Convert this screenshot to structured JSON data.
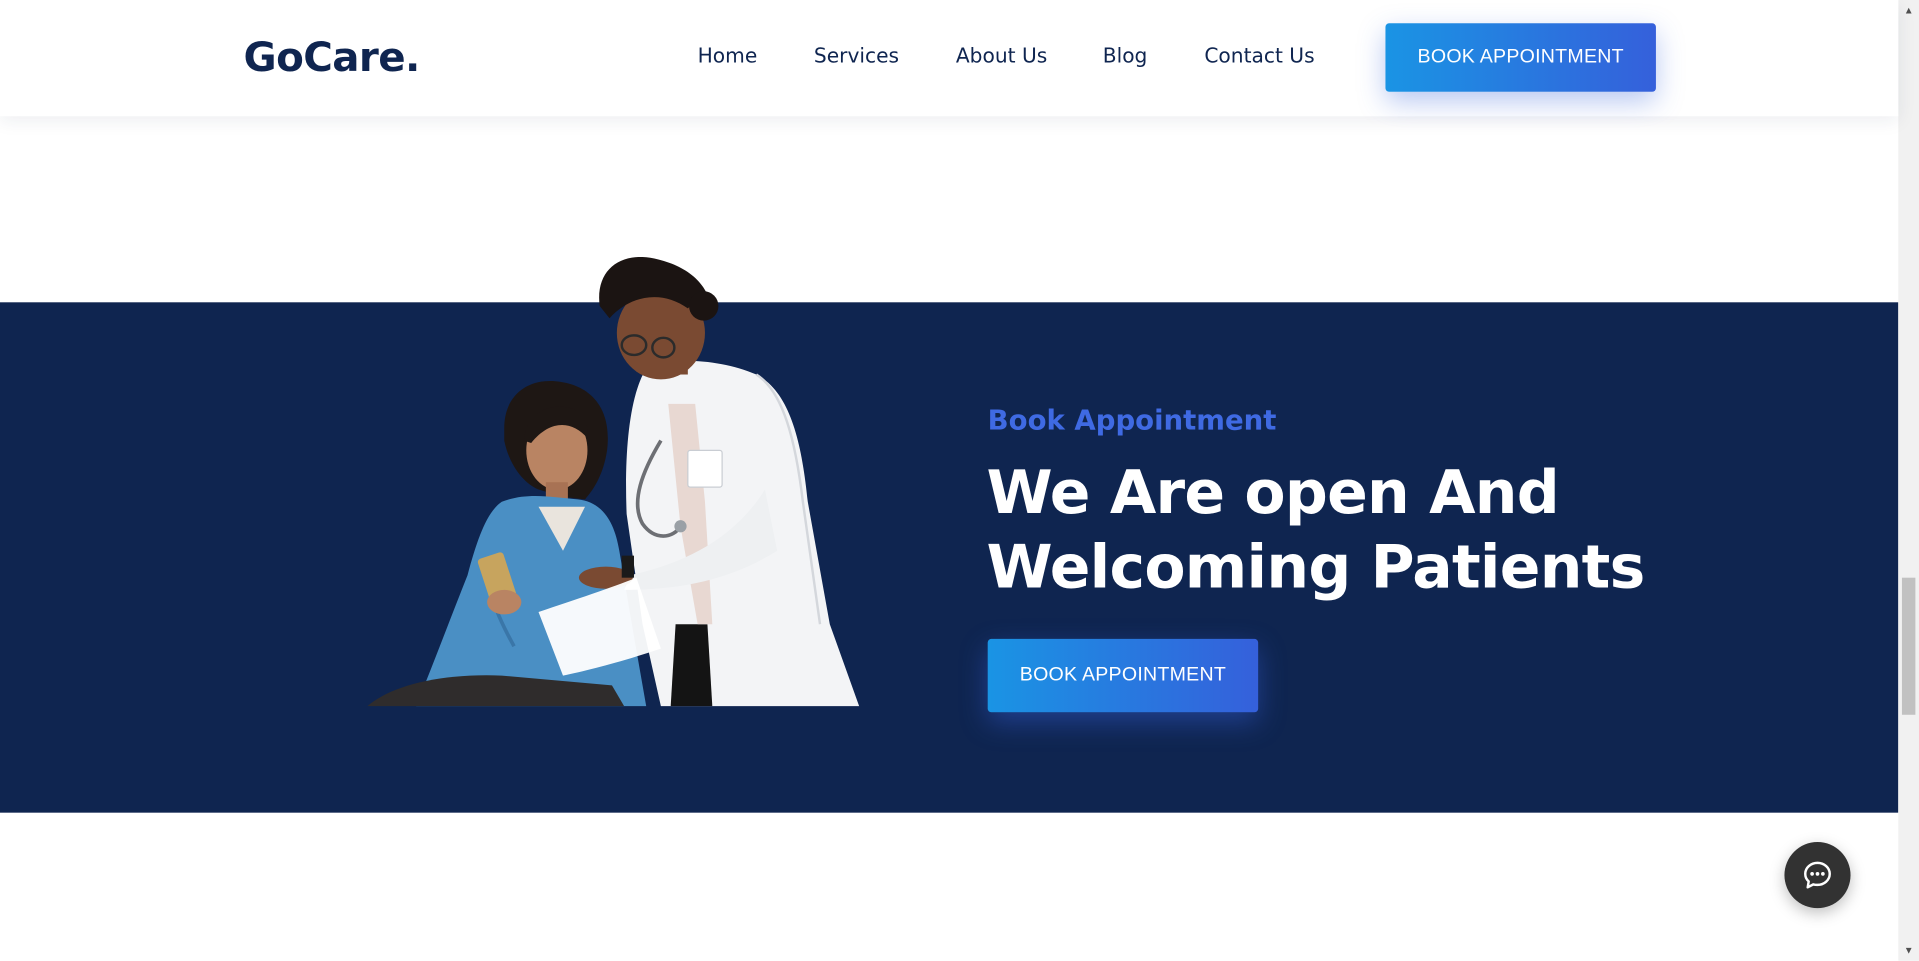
{
  "header": {
    "logo": "GoCare.",
    "nav": [
      {
        "label": "Home"
      },
      {
        "label": "Services"
      },
      {
        "label": "About Us"
      },
      {
        "label": "Blog"
      },
      {
        "label": "Contact Us"
      }
    ],
    "cta_label": "BOOK APPOINTMENT"
  },
  "appointment_section": {
    "eyebrow": "Book Appointment",
    "headline_line1": "We Are open And",
    "headline_line2": "Welcoming Patients",
    "cta_label": "BOOK APPOINTMENT",
    "background_color": "#0f2550",
    "image_icon": "doctor-and-patient-photo"
  },
  "chat_widget": {
    "icon": "chat-bubble-icon"
  },
  "colors": {
    "brand_navy": "#0f2550",
    "accent_blue": "#3f6ae3",
    "button_gradient_start": "#1a94e4",
    "button_gradient_end": "#3560db"
  }
}
